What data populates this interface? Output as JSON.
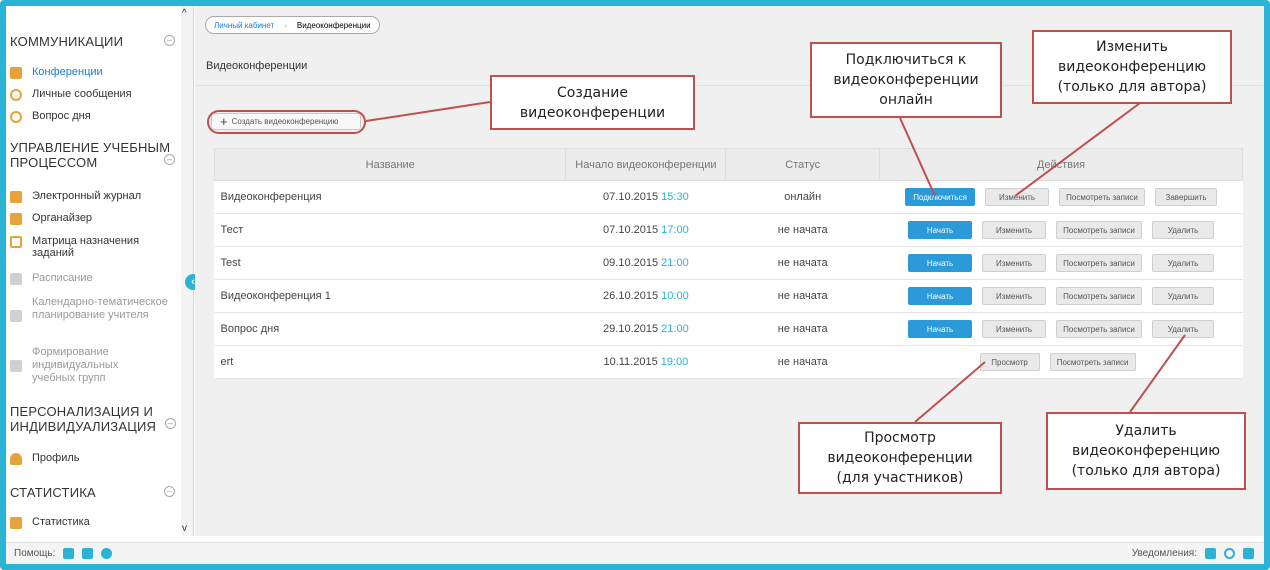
{
  "breadcrumb": [
    "Личный кабинет",
    "Видеоконференции"
  ],
  "page_title": "Видеоконференции",
  "create_button": "Создать видеоконференцию",
  "sidebar": {
    "sections": [
      {
        "title": "КОММУНИКАЦИИ"
      },
      {
        "title": "УПРАВЛЕНИЕ УЧЕБНЫМ ПРОЦЕССОМ"
      },
      {
        "title": "ПЕРСОНАЛИЗАЦИЯ И ИНДИВИДУАЛИЗАЦИЯ"
      },
      {
        "title": "СТАТИСТИКА"
      }
    ],
    "items": [
      {
        "label": "Конференции",
        "icon": "conference-icon"
      },
      {
        "label": "Личные сообщения",
        "icon": "messages-icon"
      },
      {
        "label": "Вопрос дня",
        "icon": "question-icon"
      },
      {
        "label": "Электронный журнал",
        "icon": "journal-icon"
      },
      {
        "label": "Органайзер",
        "icon": "organizer-icon"
      },
      {
        "label": "Матрица назначения заданий",
        "icon": "matrix-icon"
      },
      {
        "label": "Расписание",
        "icon": "schedule-icon"
      },
      {
        "label": "Календарно-тематическое планирование учителя",
        "icon": "calendar-plan-icon"
      },
      {
        "label": "Формирование индивидуальных учебных групп",
        "icon": "groups-icon"
      },
      {
        "label": "Профиль",
        "icon": "profile-icon"
      },
      {
        "label": "Статистика",
        "icon": "statistics-icon"
      }
    ]
  },
  "table": {
    "headers": [
      "Название",
      "Начало видеоконференции",
      "Статус",
      "Действия"
    ],
    "rows": [
      {
        "name": "Видеоконференция",
        "date": "07.10.2015",
        "time": "15:30",
        "status": "онлайн"
      },
      {
        "name": "Тест",
        "date": "07.10.2015",
        "time": "17:00",
        "status": "не начата"
      },
      {
        "name": "Test",
        "date": "09.10.2015",
        "time": "21:00",
        "status": "не начата"
      },
      {
        "name": "Видеоконференция 1",
        "date": "26.10.2015",
        "time": "10:00",
        "status": "не начата"
      },
      {
        "name": "Вопрос дня",
        "date": "29.10.2015",
        "time": "21:00",
        "status": "не начата"
      },
      {
        "name": "ert",
        "date": "10.11.2015",
        "time": "19:00",
        "status": "не начата"
      }
    ]
  },
  "actions": {
    "connect": "Подключиться",
    "start": "Начать",
    "edit": "Изменить",
    "view_records": "Посмотреть записи",
    "finish": "Завершить",
    "delete": "Удалить",
    "view": "Просмотр"
  },
  "callouts": {
    "create": "Создание видеоконференции",
    "connect": "Подключиться к видеоконференции онлайн",
    "edit": "Изменить видеоконференцию (только для автора)",
    "view": "Просмотр видеоконференции (для участников)",
    "delete": "Удалить видеоконференцию (только для автора)"
  },
  "footer": {
    "help": "Помощь:",
    "notifications": "Уведомления:"
  },
  "colors": {
    "accent": "#2bb3d6",
    "button_blue": "#2a9ad8",
    "callout_border": "#c0504d",
    "link": "#1a7dd1"
  }
}
